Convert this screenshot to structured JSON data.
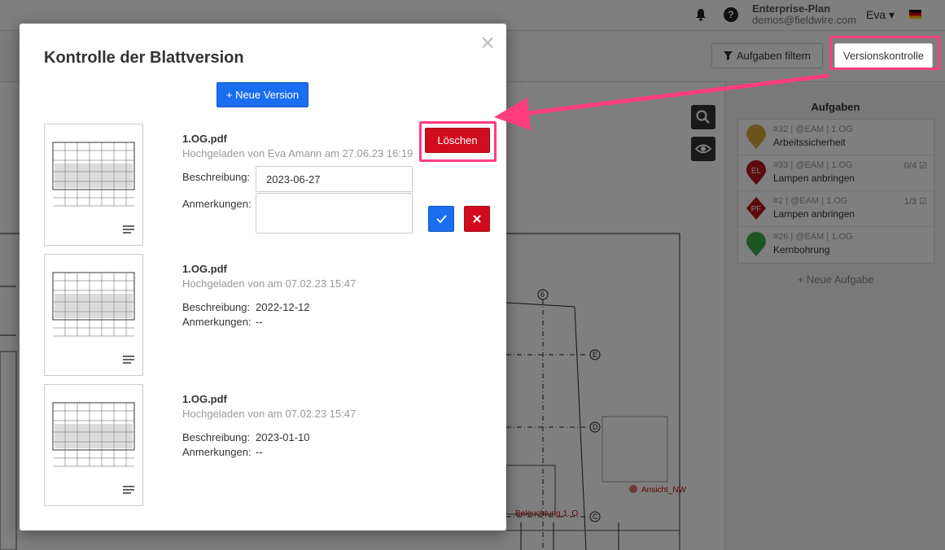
{
  "topbar": {
    "plan": "Enterprise-Plan",
    "email": "demos@fieldwire.com",
    "user": "Eva ▾",
    "help": "?",
    "icons": {
      "bell": "bell-icon",
      "help": "help-icon",
      "flag": "german-flag-icon"
    }
  },
  "toolbar": {
    "filter_label": "Aufgaben filtern",
    "version_label": "Versionskontrolle"
  },
  "plan_labels": {
    "axis_6": "6",
    "axis_e": "E",
    "axis_d": "D",
    "axis_c": "C",
    "ansicht": "Ansicht_NW",
    "beleuchtung": "Beleuchtung 1. O"
  },
  "tasks": {
    "title": "Aufgaben",
    "items": [
      {
        "meta": "#32 | @EAM | 1.OG",
        "name": "Arbeitssicherheit",
        "count": "",
        "pin_label": "",
        "pin_color": "#d9a83a"
      },
      {
        "meta": "#33 | @EAM | 1.OG",
        "name": "Lampen anbringen",
        "count": "0/4",
        "pin_label": "EL",
        "pin_color": "#b8141a"
      },
      {
        "meta": "#2 | @EAM | 1.OG",
        "name": "Lampen anbringen",
        "count": "1/3",
        "pin_label": "PF",
        "pin_color": "#b8141a"
      },
      {
        "meta": "#26 | @EAM | 1.OG",
        "name": "Kernbohrung",
        "count": "",
        "pin_label": "",
        "pin_color": "#3cab4a"
      }
    ],
    "new_label": "+ Neue Aufgabe"
  },
  "modal": {
    "title": "Kontrolle der Blattversion",
    "close": "×",
    "new_version_label": "+ Neue Version",
    "description_label": "Beschreibung:",
    "notes_label": "Anmerkungen:",
    "delete_label": "Löschen",
    "versions": [
      {
        "file": "1.OG.pdf",
        "uploaded": "Hochgeladen von Eva Amann am 27.06.23 16:19",
        "description": "2023-06-27",
        "notes": ""
      },
      {
        "file": "1.OG.pdf",
        "uploaded": "Hochgeladen von am 07.02.23 15:47",
        "description": "2022-12-12",
        "notes": "--"
      },
      {
        "file": "1.OG.pdf",
        "uploaded": "Hochgeladen von am 07.02.23 15:47",
        "description": "2023-01-10",
        "notes": "--"
      }
    ]
  },
  "colors": {
    "primary": "#1b6ef0",
    "danger": "#d10c1f",
    "highlight": "#ff3d7f"
  }
}
